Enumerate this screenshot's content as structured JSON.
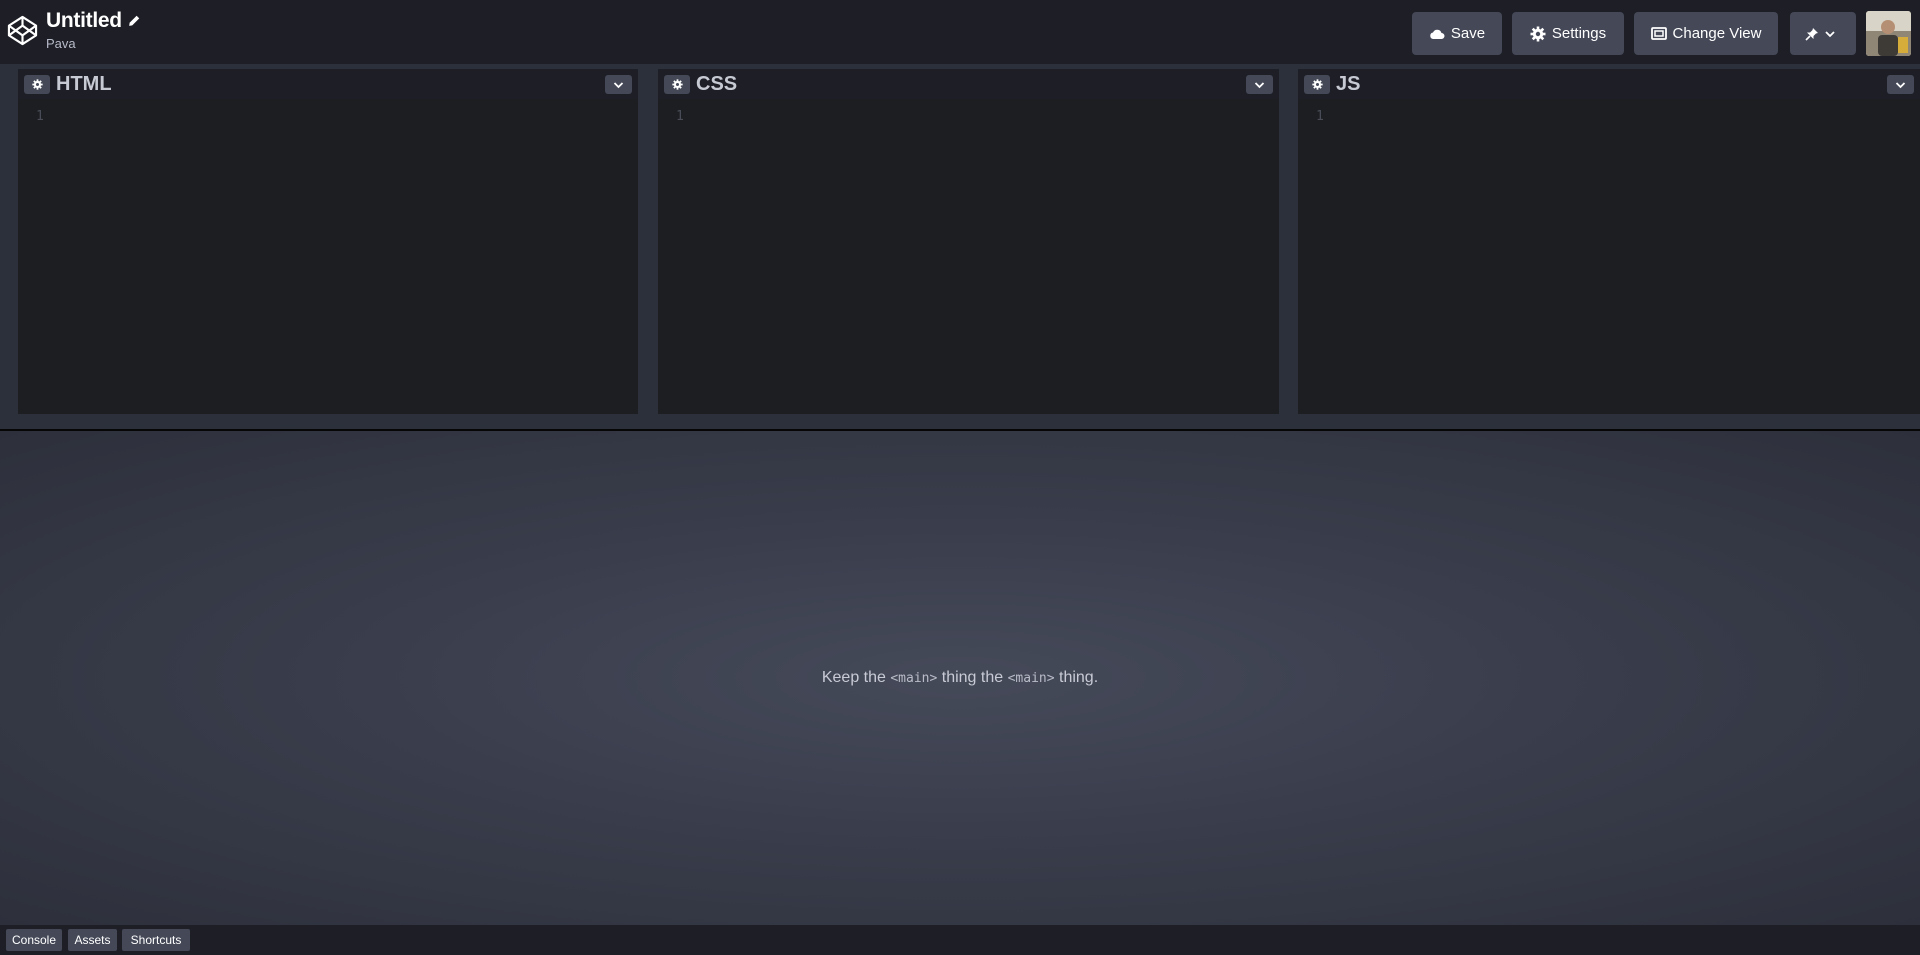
{
  "header": {
    "title": "Untitled",
    "author": "Pava",
    "save_label": "Save",
    "settings_label": "Settings",
    "change_view_label": "Change View"
  },
  "editors": [
    {
      "title": "HTML",
      "line_number": "1"
    },
    {
      "title": "CSS",
      "line_number": "1"
    },
    {
      "title": "JS",
      "line_number": "1"
    }
  ],
  "preview": {
    "text_before": "Keep the ",
    "code1": "<main>",
    "text_middle": " thing the ",
    "code2": "<main>",
    "text_after": " thing."
  },
  "footer": {
    "console_label": "Console",
    "assets_label": "Assets",
    "shortcuts_label": "Shortcuts"
  },
  "colors": {
    "header_bg": "#1e1f26",
    "button_bg": "#444857",
    "editor_bg": "#1d1e22",
    "preview_center": "#454a59"
  }
}
